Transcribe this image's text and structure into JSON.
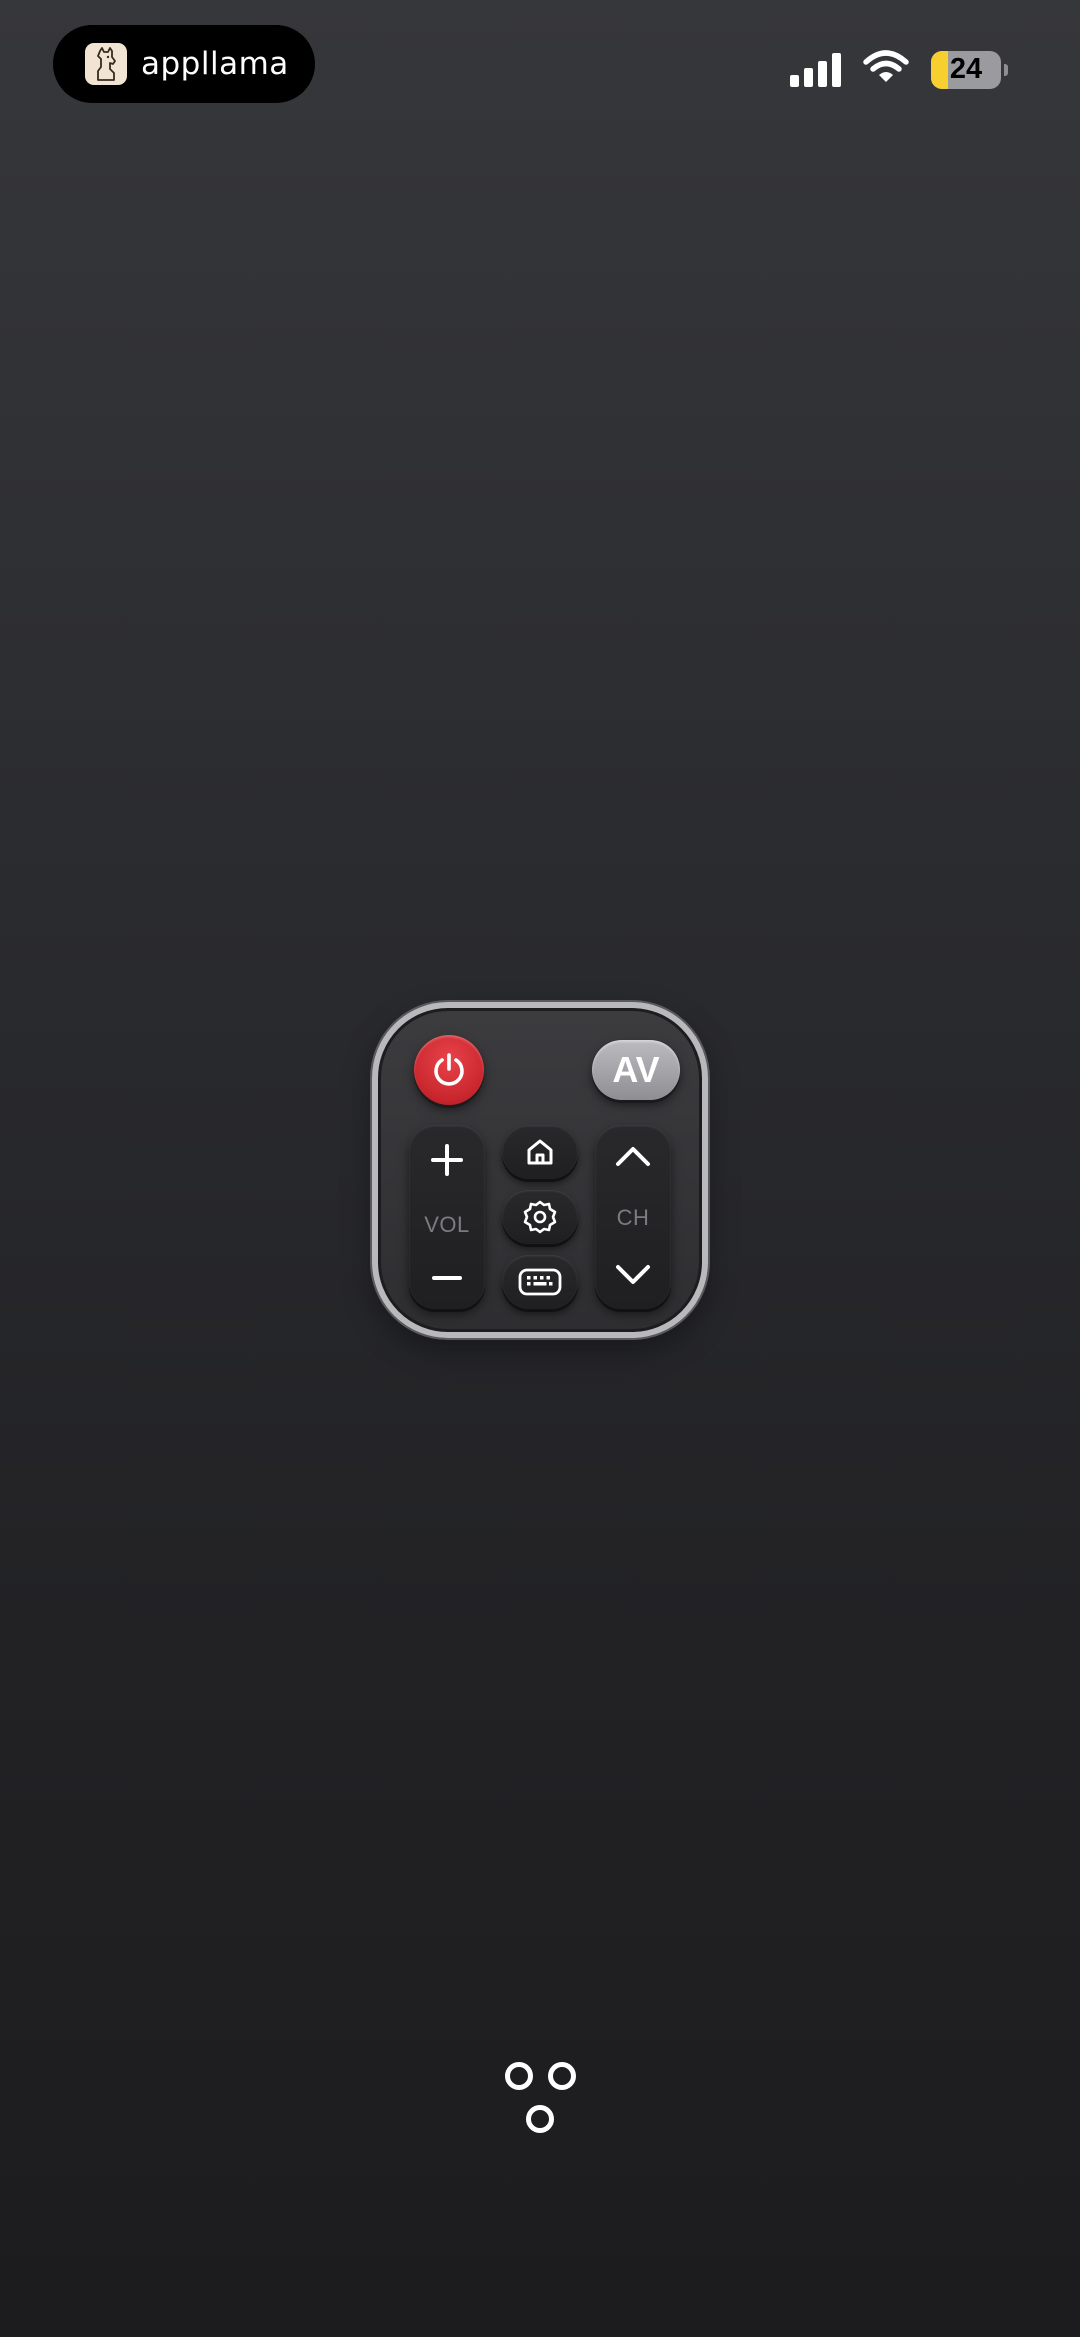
{
  "status_bar": {
    "pill_label": "appllama",
    "pill_icon": "llama-icon",
    "battery_level": 24,
    "battery_text": "24",
    "signal_icon": "cellular-signal-icon",
    "wifi_icon": "wifi-icon",
    "battery_fill_color": "#f7cf2e"
  },
  "remote": {
    "power_icon": "power-icon",
    "power_color": "#d32f35",
    "av_label": "AV",
    "vol_label": "VOL",
    "vol_up_icon": "plus-icon",
    "vol_down_icon": "minus-icon",
    "ch_label": "CH",
    "ch_up_icon": "chevron-up-icon",
    "ch_down_icon": "chevron-down-icon",
    "home_icon": "home-icon",
    "settings_icon": "gear-icon",
    "keyboard_icon": "keyboard-icon"
  },
  "dock_icon": "more-dots-icon"
}
